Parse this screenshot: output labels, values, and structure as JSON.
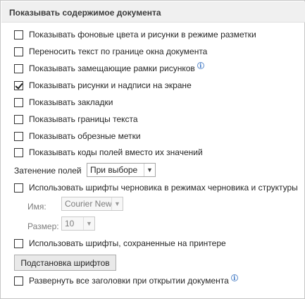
{
  "section": {
    "title": "Показывать содержимое документа"
  },
  "options": [
    {
      "label": "Показывать фоновые цвета и рисунки в режиме разметки",
      "checked": false,
      "info": false
    },
    {
      "label": "Переносить текст по границе окна документа",
      "checked": false,
      "info": false
    },
    {
      "label": "Показывать замещающие рамки рисунков",
      "checked": false,
      "info": true
    },
    {
      "label": "Показывать рисунки и надписи на экране",
      "checked": true,
      "info": false
    },
    {
      "label": "Показывать закладки",
      "checked": false,
      "info": false
    },
    {
      "label": "Показывать границы текста",
      "checked": false,
      "info": false
    },
    {
      "label": "Показывать обрезные метки",
      "checked": false,
      "info": false
    },
    {
      "label": "Показывать коды полей вместо их значений",
      "checked": false,
      "info": false
    }
  ],
  "field_shading": {
    "label": "Затенение полей",
    "value": "При выборе"
  },
  "draft_font": {
    "label": "Использовать шрифты черновика в режимах черновика и структуры",
    "checked": false,
    "name_label": "Имя:",
    "name_value": "Courier New",
    "size_label": "Размер:",
    "size_value": "10"
  },
  "printer_fonts": {
    "label": "Использовать шрифты, сохраненные на принтере",
    "checked": false
  },
  "font_substitution_button": "Подстановка шрифтов",
  "expand_headings": {
    "label": "Развернуть все заголовки при открытии документа",
    "checked": false,
    "info": true
  },
  "icons": {
    "info": "info-icon",
    "dropdown": "chevron-down-icon",
    "check": "checkmark-icon"
  }
}
